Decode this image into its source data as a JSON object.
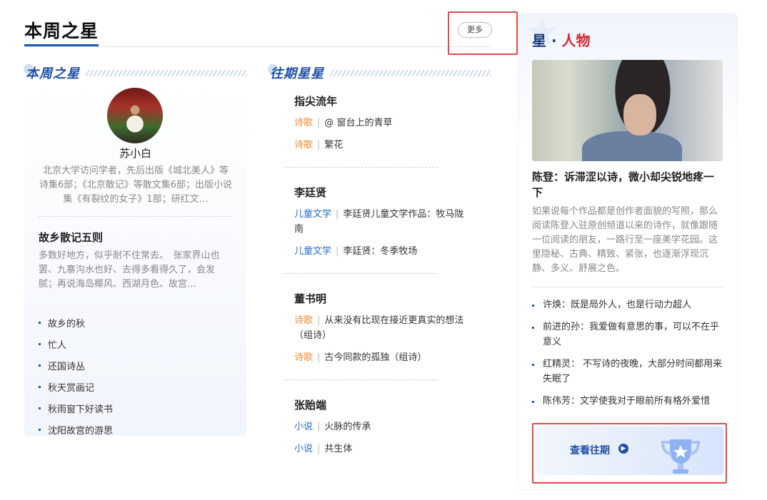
{
  "page": {
    "title": "本周之星",
    "more_label": "更多"
  },
  "weekly_star": {
    "heading": "本周之星",
    "author_name": "苏小白",
    "author_bio": "北京大学访问学者，先后出版《城北美人》等诗集6部；《北京散记》等散文集6部；出版小说集《有裂纹的女子》1部；研红文…",
    "work_title": "故乡散记五则",
    "work_excerpt": "多数好地方，似乎耐不住常去。　张家界山也罢、九寨沟水也好、去得多看得久了，会发腻；再说海岛椰风、西湖月色、故宫…",
    "items": [
      "故乡的秋",
      "忙人",
      "还国诗丛",
      "秋天赏画记",
      "秋雨窗下好读书",
      "沈阳故宫的游思"
    ]
  },
  "past_stars": {
    "heading": "往期星星",
    "entries": [
      {
        "name": "指尖流年",
        "works": [
          {
            "category": "诗歌",
            "title": "@ 窗台上的青草"
          },
          {
            "category": "诗歌",
            "title": "繁花"
          }
        ]
      },
      {
        "name": "李廷贤",
        "works": [
          {
            "category": "儿童文学",
            "title": "李廷贤儿童文学作品：牧马陇南"
          },
          {
            "category": "儿童文学",
            "title": "李廷贤：冬季牧场"
          }
        ]
      },
      {
        "name": "董书明",
        "works": [
          {
            "category": "诗歌",
            "title": "从来没有比现在接近更真实的想法（组诗）"
          },
          {
            "category": "诗歌",
            "title": "古今同款的孤独（组诗）"
          }
        ]
      },
      {
        "name": "张贻端",
        "works": [
          {
            "category": "小说",
            "title": "火脉的传承"
          },
          {
            "category": "小说",
            "title": "共生体"
          }
        ]
      }
    ]
  },
  "star_people": {
    "title_prefix": "星 · ",
    "title_accent": "人物",
    "headline": "陈登：诉滞涩以诗，微小却尖锐地疼一下",
    "description": "如果说每个作品都是创作者面貌的写照，那么阅读陈登入驻原创频道以来的诗作，就像跟随一位阅读的朋友，一路行至一座美学花园。这里隐秘、古典、精致、紧张，也逐渐浮现沉静、多义、舒展之色。",
    "quotes": [
      "许焕：既是局外人，也是行动力超人",
      "前进的孙：我爱做有意思的事，可以不在乎意义",
      "红精灵： 不写诗的夜晚，大部分时间都用来失眠了",
      "陈伟芳：文学使我对于眼前所有格外爱惜"
    ],
    "view_past_label": "查看往期"
  },
  "colors": {
    "accent_blue": "#1f57b8",
    "poetry_orange": "#f08a33",
    "category_blue": "#2a6bd1",
    "highlight_red": "#e8484a"
  }
}
